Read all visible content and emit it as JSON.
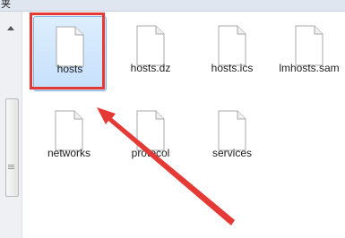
{
  "window": {
    "title_fragment": "夹"
  },
  "files": [
    {
      "name": "hosts",
      "selected": true
    },
    {
      "name": "hosts.dz",
      "selected": false
    },
    {
      "name": "hosts.ics",
      "selected": false
    },
    {
      "name": "lmhosts.sam",
      "selected": false
    },
    {
      "name": "networks",
      "selected": false
    },
    {
      "name": "protocol",
      "selected": false
    },
    {
      "name": "services",
      "selected": false
    }
  ],
  "annotation": {
    "highlight_color": "#e53935"
  }
}
